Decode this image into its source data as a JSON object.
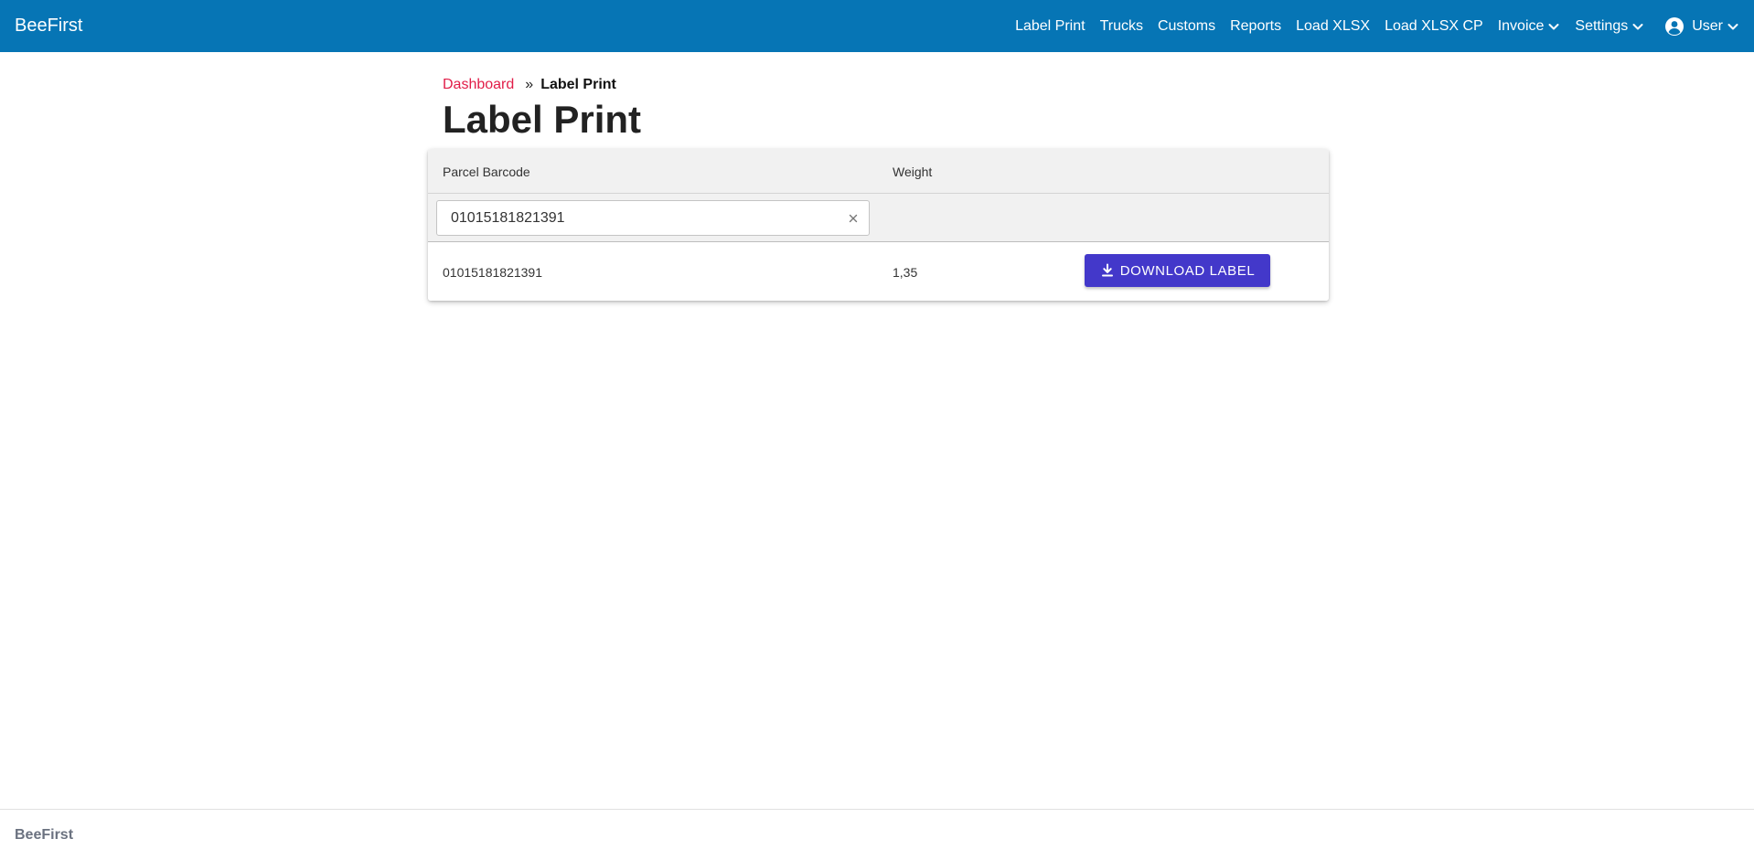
{
  "navbar": {
    "brand": "BeeFirst",
    "links": [
      {
        "label": "Label Print"
      },
      {
        "label": "Trucks"
      },
      {
        "label": "Customs"
      },
      {
        "label": "Reports"
      },
      {
        "label": "Load XLSX"
      },
      {
        "label": "Load XLSX CP"
      }
    ],
    "invoice_label": "Invoice",
    "settings_label": "Settings",
    "user_label": "User",
    "icons": {
      "dropdown": "chevron-down-icon",
      "user": "user-circle-icon"
    },
    "background_color": "#0675b5"
  },
  "breadcrumb": {
    "link_label": "Dashboard",
    "separator": "»",
    "current": "Label Print",
    "link_color": "#e11d48"
  },
  "page_title": "Label Print",
  "table": {
    "columns": [
      "Parcel Barcode",
      "Weight"
    ],
    "filter": {
      "barcode_value": "01015181821391",
      "clear_icon": "close-icon"
    },
    "rows": [
      {
        "barcode": "01015181821391",
        "weight": "1,35",
        "action_label": "Download Label",
        "action_icon": "download-icon"
      }
    ]
  },
  "accent_color": "#4338ca",
  "footer": {
    "brand": "BeeFirst"
  }
}
